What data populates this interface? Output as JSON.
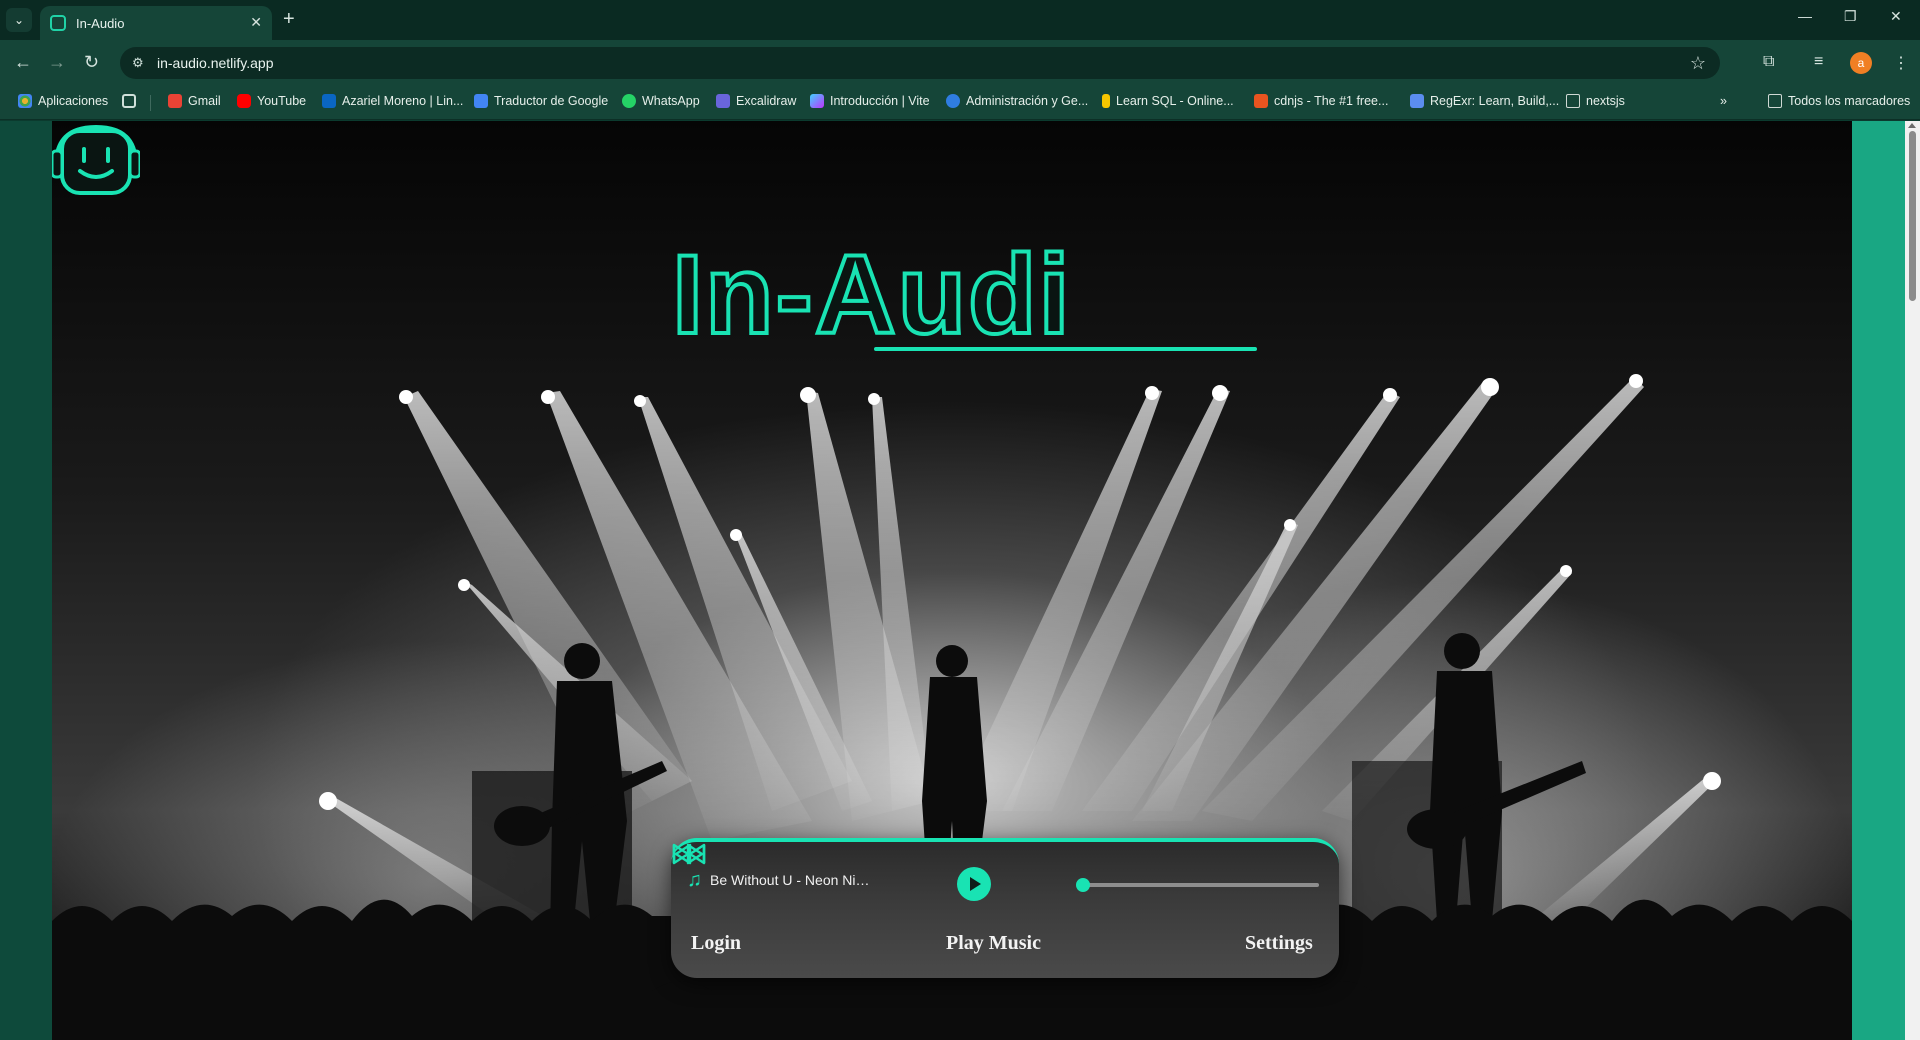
{
  "browser": {
    "tab_title": "In-Audio",
    "url": "in-audio.netlify.app",
    "profile_initial": "a",
    "bookmarks": [
      {
        "label": "Aplicaciones",
        "color": "#e8b22f"
      },
      {
        "label": "Gmail",
        "color": "#ea4335"
      },
      {
        "label": "YouTube",
        "color": "#ff0000"
      },
      {
        "label": "Azariel Moreno | Lin...",
        "color": "#0a66c2"
      },
      {
        "label": "Traductor de Google",
        "color": "#4285f4"
      },
      {
        "label": "WhatsApp",
        "color": "#25d366"
      },
      {
        "label": "Excalidraw",
        "color": "#6965db"
      },
      {
        "label": "Introducción | Vite",
        "color": "#bd34fe"
      },
      {
        "label": "Administración y Ge...",
        "color": "#2f7de1"
      },
      {
        "label": "Learn SQL - Online...",
        "color": "#f7c600"
      },
      {
        "label": "cdnjs - The #1 free...",
        "color": "#e95420"
      },
      {
        "label": "RegExr: Learn, Build,...",
        "color": "#5b8def"
      },
      {
        "label": "nextsjs",
        "color": "#cfd8d4"
      }
    ],
    "all_bookmarks_label": "Todos los marcadores"
  },
  "page": {
    "logo_text": "In-Audi",
    "accent_color": "#19e3b3",
    "player": {
      "track": "Be Without U - Neon Nights",
      "progress": 0.0
    },
    "nav": {
      "login": "Login",
      "play_music": "Play Music",
      "settings": "Settings"
    }
  }
}
